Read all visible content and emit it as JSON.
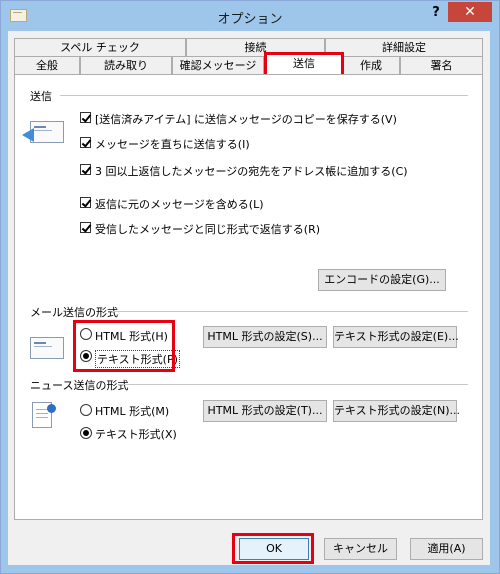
{
  "window": {
    "title": "オプション",
    "help_label": "?",
    "close_label": "✕"
  },
  "tabs_row1": [
    {
      "label": "スペル チェック"
    },
    {
      "label": "接続"
    },
    {
      "label": "詳細設定"
    }
  ],
  "tabs_row2": [
    {
      "label": "全般"
    },
    {
      "label": "読み取り"
    },
    {
      "label": "確認メッセージ"
    },
    {
      "label": "送信",
      "selected": true
    },
    {
      "label": "作成"
    },
    {
      "label": "署名"
    }
  ],
  "send_group": {
    "title": "送信",
    "options": [
      {
        "label": "[送信済みアイテム] に送信メッセージのコピーを保存する(V)",
        "checked": true
      },
      {
        "label": "メッセージを直ちに送信する(I)",
        "checked": true
      },
      {
        "label": "3 回以上返信したメッセージの宛先をアドレス帳に追加する(C)",
        "checked": true
      },
      {
        "label": "返信に元のメッセージを含める(L)",
        "checked": true
      },
      {
        "label": "受信したメッセージと同じ形式で返信する(R)",
        "checked": true
      }
    ],
    "encode_button": "エンコードの設定(G)..."
  },
  "mail_format": {
    "title": "メール送信の形式",
    "html_option": "HTML 形式(H)",
    "text_option": "テキスト形式(P)",
    "selected": "text",
    "html_settings_button": "HTML 形式の設定(S)...",
    "text_settings_button": "テキスト形式の設定(E)..."
  },
  "news_format": {
    "title": "ニュース送信の形式",
    "html_option": "HTML 形式(M)",
    "text_option": "テキスト形式(X)",
    "selected": "text",
    "html_settings_button": "HTML 形式の設定(T)...",
    "text_settings_button": "テキスト形式の設定(N)..."
  },
  "footer": {
    "ok": "OK",
    "cancel": "キャンセル",
    "apply": "適用(A)"
  },
  "colors": {
    "highlight": "#e60012",
    "titlebar": "#9ec6ea",
    "close": "#c7463c"
  }
}
